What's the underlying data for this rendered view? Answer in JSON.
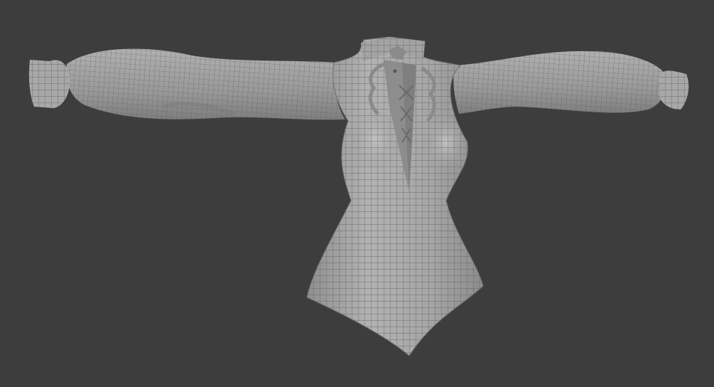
{
  "viewport": {
    "background": "#3d3d3d",
    "object": "shirt-mesh",
    "shading": "solid-wireframe",
    "mesh_fill": "#9c9c9c",
    "mesh_light": "#b4b4b4",
    "wire_color": "#5a5a5a"
  }
}
